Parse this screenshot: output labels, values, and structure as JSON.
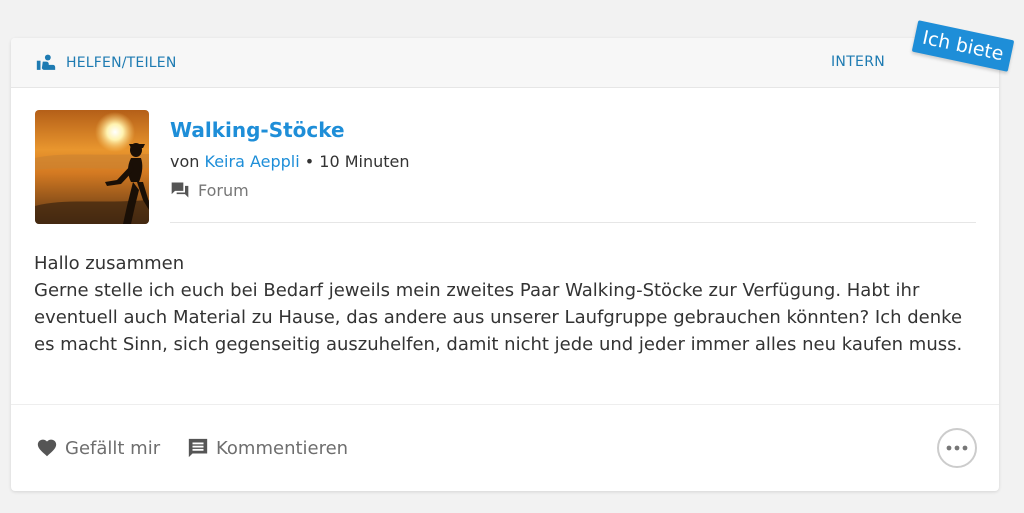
{
  "header": {
    "category_label": "HELFEN/TEILEN",
    "visibility": "INTERN",
    "ribbon": "Ich biete",
    "category_icon": "helping-hands-icon",
    "ribbon_color": "#1e8ed8"
  },
  "post": {
    "title": "Walking-Stöcke",
    "meta_prefix": "von",
    "author": "Keira Aeppli",
    "separator": "•",
    "time": "10 Minuten",
    "channel": "Forum",
    "channel_icon": "forum-icon",
    "thumbnail": "sunset-runner-image",
    "body": [
      "Hallo zusammen",
      "Gerne stelle ich euch bei Bedarf jeweils mein zweites Paar Walking-Stöcke zur Verfügung. Habt ihr eventuell auch Material zu Hause, das andere aus unserer Laufgruppe gebrauchen könnten? Ich denke es macht Sinn, sich gegenseitig auszuhelfen, damit nicht jede und jeder immer alles neu kaufen muss."
    ]
  },
  "actions": {
    "like": "Gefällt mir",
    "comment": "Kommentieren",
    "like_icon": "heart-icon",
    "comment_icon": "comment-icon",
    "more_icon": "more-horizontal-icon"
  },
  "colors": {
    "accent": "#1e8ed8",
    "link": "#1e7bb2",
    "text": "#333333",
    "muted": "#6e6e6e",
    "background": "#f2f2f2"
  }
}
